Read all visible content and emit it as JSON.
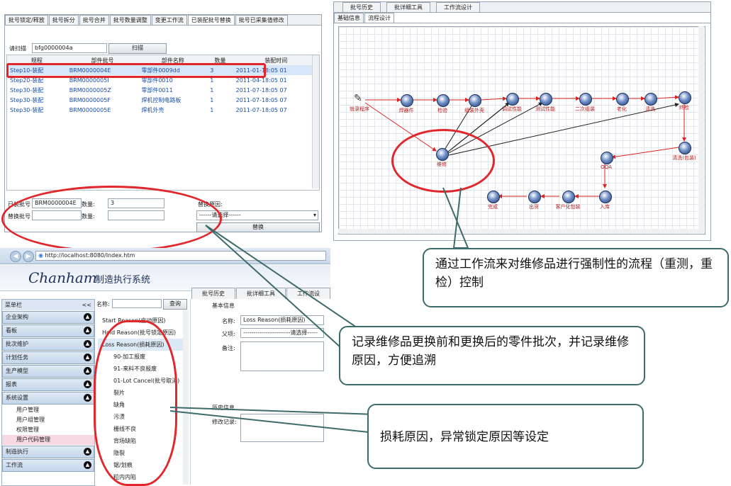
{
  "top_left": {
    "tabs": [
      "批号锁定/释放",
      "批号拆分",
      "批号合并",
      "批号数量调整",
      "变更工作流",
      "已装配批号替换",
      "批号已采集值修改"
    ],
    "active_tab": 5,
    "scan_label": "请扫描",
    "scan_value": "bfg0000004a",
    "scan_button": "扫描",
    "columns": [
      "规程",
      "部件批号",
      "部件名称",
      "数量",
      "装配时间"
    ],
    "rows": [
      [
        "Step10-装配",
        "BRM0000004E",
        "零部件0009dd",
        "3",
        "2011-01-18:05 01"
      ],
      [
        "Step20-装配",
        "BRM0000005I",
        "零部件0010",
        "1",
        "2011-04-18:05 01"
      ],
      [
        "Step30-装配",
        "BRM0000005Z",
        "零部件0011",
        "1",
        "2011-07-18:05 07"
      ],
      [
        "Step30-装配",
        "BRM0000005F",
        "焊机控制电路板",
        "1",
        "2011-07-18:05 07"
      ],
      [
        "Step30-装配",
        "BRM0000005E",
        "焊机外壳",
        "1",
        "2011-07-18:05 07"
      ]
    ],
    "installed_label": "已装批号",
    "installed_value": "BRM0000004E",
    "qty_label": "数量:",
    "qty_value": "3",
    "replace_label": "替换批号",
    "replace_qty_label": "数量:",
    "reason_label": "替换原因:",
    "reason_select": "------请选择------",
    "replace_button": "替换"
  },
  "top_right": {
    "tabs": [
      "批号历史",
      "批详细工具",
      "工作流设计"
    ],
    "subtabs": [
      "基础信息",
      "流程设计"
    ],
    "nodes": [
      "就录程序",
      "焊器件",
      "检验",
      "组装外壳",
      "调试性能",
      "测试性能",
      "二次组装",
      "老化",
      "清洗",
      "终检",
      "维修",
      "清洗(包装)",
      "OQA",
      "入库",
      "客户化包装",
      "出货",
      "完成"
    ]
  },
  "bottom_left": {
    "url": "http://localhost:8080/Index.htm",
    "brand": "Chanham",
    "system_title": "制造执行系统",
    "tabs": [
      "批号历史",
      "批详细工具",
      "工作流设"
    ],
    "menu_title": "菜单栏",
    "menu_collapse": "<<",
    "nav": [
      {
        "label": "企业架构"
      },
      {
        "label": "看板"
      },
      {
        "label": "批次维护"
      },
      {
        "label": "计划任务"
      },
      {
        "label": "生产模型"
      },
      {
        "label": "报表"
      },
      {
        "label": "系统设置"
      }
    ],
    "sub_items": [
      "用户管理",
      "用户组管理",
      "权限管理",
      "用户代码管理"
    ],
    "nav_bottom": [
      {
        "label": "制造执行"
      },
      {
        "label": "工作流"
      }
    ],
    "search_label": "名称:",
    "search_button": "查询",
    "tree": [
      "Start Reason(启动原因)",
      "Hold Reason(批号锁定原因)",
      "Loss Reason(损耗原因)",
      "90-加工报废",
      "91-来料不良报废",
      "01-Lot Cancel(批号取消)",
      "裂片",
      "缺角",
      "污渍",
      "栅线不良",
      "背场缺陷",
      "隐裂",
      "锯/划痕",
      "粒内内陷"
    ],
    "basic_info": "基本信息",
    "name_label": "名称:",
    "name_value": "Loss Reason(损耗原因)",
    "parent_label": "父项:",
    "parent_value": "-----------------------请选择-----",
    "note_label": "备注:",
    "history_label": "历史信息",
    "modify_label": "修改记录:"
  },
  "callouts": [
    "通过工作流来对维修品进行强制性的流程（重测，重检）控制",
    "记录维修品更换前和更换后的零件批次，并记录维修原因，方便追溯",
    "损耗原因，异常锁定原因等设定"
  ],
  "colors": {
    "ring": "#e1262c",
    "callout_border": "#3d6b6b",
    "link": "#1d4fa8"
  }
}
